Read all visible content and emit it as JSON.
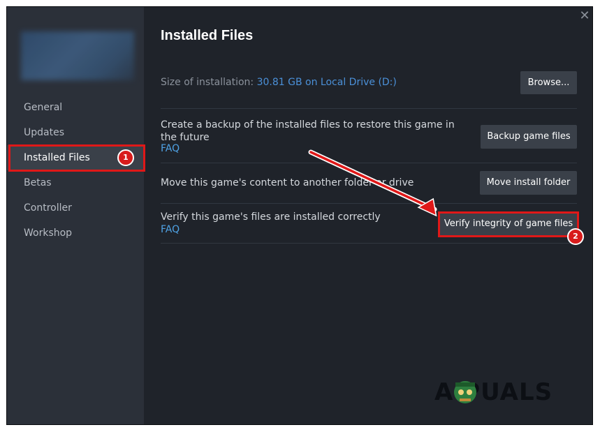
{
  "window": {
    "close_glyph": "✕"
  },
  "sidebar": {
    "items": [
      {
        "label": "General"
      },
      {
        "label": "Updates"
      },
      {
        "label": "Installed Files"
      },
      {
        "label": "Betas"
      },
      {
        "label": "Controller"
      },
      {
        "label": "Workshop"
      }
    ]
  },
  "main": {
    "title": "Installed Files",
    "size_label": "Size of installation:",
    "size_value": "30.81 GB on Local Drive (D:)",
    "browse_label": "Browse...",
    "backup": {
      "text": "Create a backup of the installed files to restore this game in the future",
      "faq": "FAQ",
      "button": "Backup game files"
    },
    "move": {
      "text": "Move this game's content to another folder or drive",
      "button": "Move install folder"
    },
    "verify": {
      "text": "Verify this game's files are installed correctly",
      "faq": "FAQ",
      "button": "Verify integrity of game files"
    }
  },
  "annotations": {
    "step1": "1",
    "step2": "2",
    "color": "#e01818"
  },
  "watermark": "A  PUALS",
  "icons": [
    "close-icon",
    "arrow-annotation",
    "mascot-icon"
  ]
}
